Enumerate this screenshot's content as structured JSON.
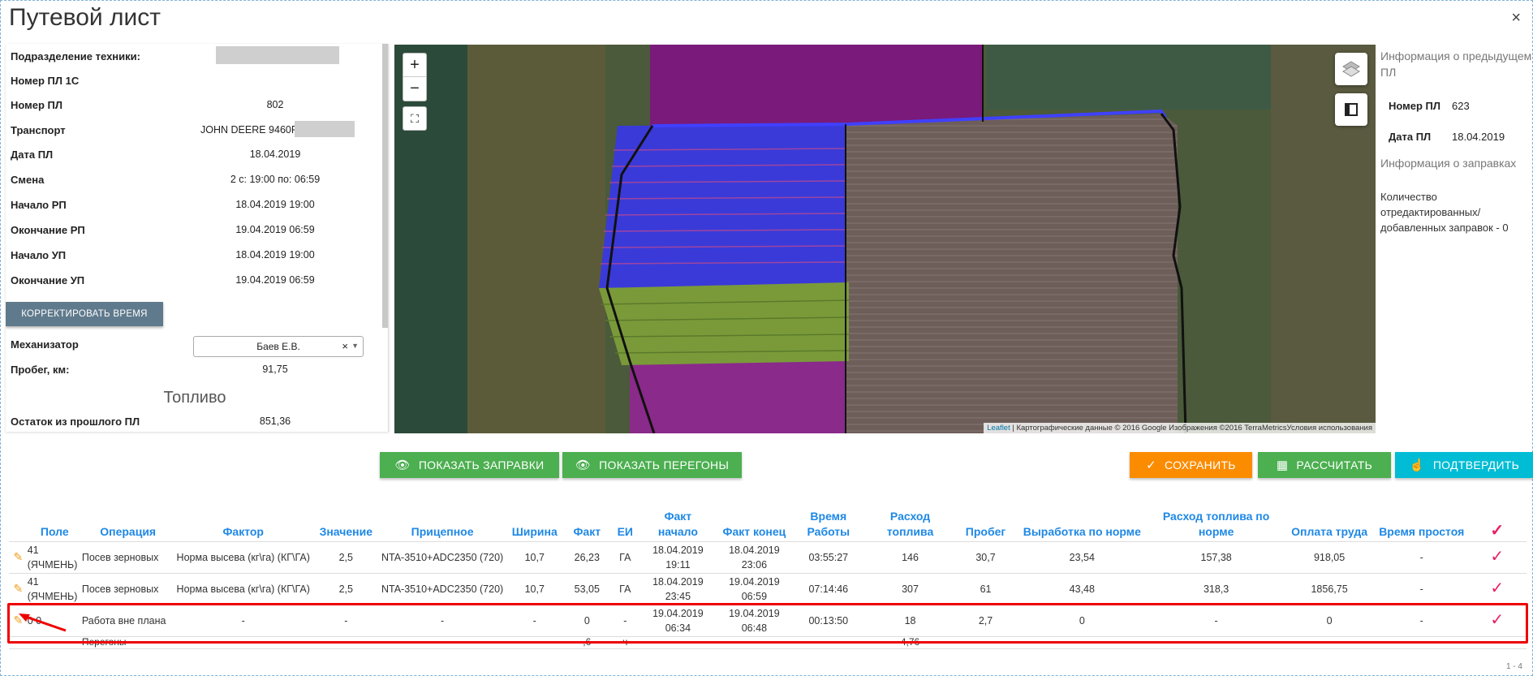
{
  "window": {
    "title": "Путевой лист",
    "close": "×"
  },
  "left": {
    "fields": [
      {
        "label": "Подразделение техники:",
        "value": ""
      },
      {
        "label": "Номер ПЛ 1С",
        "value": ""
      },
      {
        "label": "Номер ПЛ",
        "value": "802"
      },
      {
        "label": "Транспорт",
        "value": "JOHN DEERE 9460R"
      },
      {
        "label": "Дата ПЛ",
        "value": "18.04.2019"
      },
      {
        "label": "Смена",
        "value": "2 с: 19:00 по: 06:59"
      },
      {
        "label": "Начало РП",
        "value": "18.04.2019 19:00"
      },
      {
        "label": "Окончание РП",
        "value": "19.04.2019 06:59"
      },
      {
        "label": "Начало УП",
        "value": "18.04.2019 19:00"
      },
      {
        "label": "Окончание УП",
        "value": "19.04.2019 06:59"
      }
    ],
    "correct_button": "КОРРЕКТИРОВАТЬ ВРЕМЯ",
    "mechanic_label": "Механизатор",
    "mechanic_value": "Баев Е.В.",
    "mechanic_clear": "×",
    "mileage_label": "Пробег, км:",
    "mileage_value": "91,75",
    "fuel_heading": "Топливо",
    "remain_label": "Остаток из прошлого ПЛ",
    "remain_value": "851,36"
  },
  "map": {
    "zoom_in": "+",
    "zoom_out": "−",
    "attribution_link": "Leaflet",
    "attribution_text": " | Картографические данные © 2016 Google Изображения ©2016 TerraMetricsУсловия использования"
  },
  "right": {
    "prev_heading": "Информация о предыдущем ПЛ",
    "prev_num_label": "Номер ПЛ",
    "prev_num_value": "623",
    "prev_date_label": "Дата ПЛ",
    "prev_date_value": "18.04.2019",
    "refuel_heading": "Информация о заправках",
    "refuel_text": "Количество отредактированных/ добавленных заправок - 0"
  },
  "actions": {
    "show_refuels": "ПОКАЗАТЬ ЗАПРАВКИ",
    "show_transfers": "ПОКАЗАТЬ ПЕРЕГОНЫ",
    "save": "СОХРАНИТЬ",
    "calculate": "РАССЧИТАТЬ",
    "confirm": "ПОДТВЕРДИТЬ"
  },
  "table": {
    "headers": [
      "Поле",
      "Операция",
      "Фактор",
      "Значение",
      "Прицепное",
      "Ширина",
      "Факт",
      "ЕИ",
      "Факт начало",
      "Факт конец",
      "Время Работы",
      "Расход топлива",
      "Пробег",
      "Выработка по норме",
      "Расход топлива по норме",
      "Оплата труда",
      "Время простоя"
    ],
    "rows": [
      [
        "41 (ЯЧМЕНЬ)",
        "Посев зерновых",
        "Норма высева (кг\\га) (КГ\\ГА)",
        "2,5",
        "NTA-3510+ADC2350 (720)",
        "10,7",
        "26,23",
        "ГА",
        "18.04.2019 19:11",
        "18.04.2019 23:06",
        "03:55:27",
        "146",
        "30,7",
        "23,54",
        "157,38",
        "918,05",
        "-"
      ],
      [
        "41 (ЯЧМЕНЬ)",
        "Посев зерновых",
        "Норма высева (кг\\га) (КГ\\ГА)",
        "2,5",
        "NTA-3510+ADC2350 (720)",
        "10,7",
        "53,05",
        "ГА",
        "18.04.2019 23:45",
        "19.04.2019 06:59",
        "07:14:46",
        "307",
        "61",
        "43,48",
        "318,3",
        "1856,75",
        "-"
      ],
      [
        "0 0",
        "Работа вне плана",
        "-",
        "-",
        "-",
        "-",
        "0",
        "-",
        "19.04.2019 06:34",
        "19.04.2019 06:48",
        "00:13:50",
        "18",
        "2,7",
        "0",
        "-",
        "0",
        "-"
      ],
      [
        "-",
        "Перегоны",
        "-",
        "-",
        "-",
        "-",
        ",6",
        "ч",
        "",
        "",
        "",
        "4,76",
        "",
        "",
        "",
        "",
        ""
      ]
    ],
    "footer": "1 - 4"
  }
}
